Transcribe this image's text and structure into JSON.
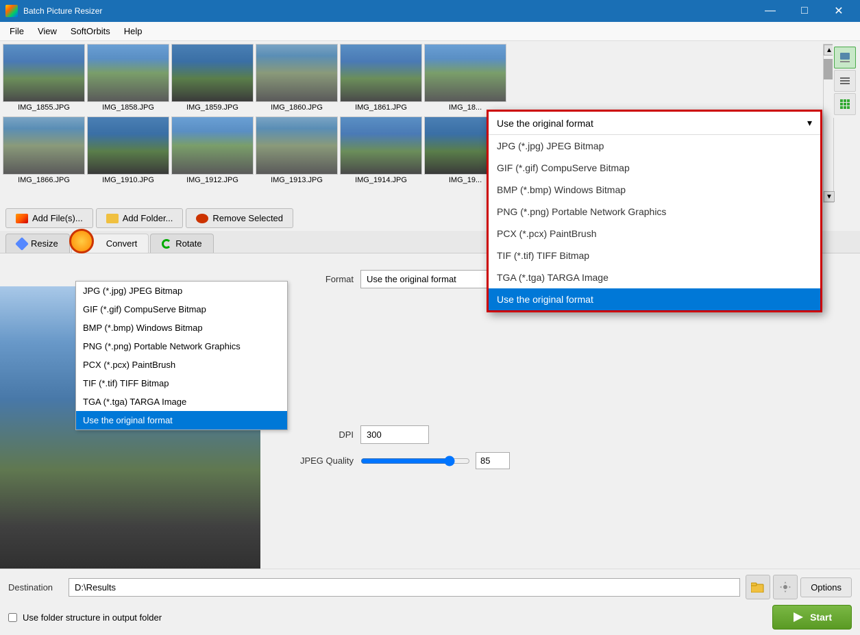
{
  "app": {
    "title": "Batch Picture Resizer",
    "icon_label": "app-icon"
  },
  "title_bar": {
    "title": "Batch Picture Resizer",
    "minimize": "—",
    "maximize": "□",
    "close": "✕"
  },
  "menu": {
    "items": [
      "File",
      "View",
      "SoftOrbits",
      "Help"
    ]
  },
  "thumbnails": [
    {
      "label": "IMG_1855.JPG",
      "style": "sea-img"
    },
    {
      "label": "IMG_1858.JPG",
      "style": "sea-img2"
    },
    {
      "label": "IMG_1859.JPG",
      "style": "sea-img3"
    },
    {
      "label": "IMG_1860.JPG",
      "style": "rocks-img"
    },
    {
      "label": "IMG_1861.JPG",
      "style": "sea-img"
    },
    {
      "label": "IMG_18...",
      "style": "sea-img2"
    },
    {
      "label": "IMG_1866.JPG",
      "style": "rocks-img"
    },
    {
      "label": "IMG_1910.JPG",
      "style": "sea-img3"
    },
    {
      "label": "IMG_1912.JPG",
      "style": "sea-img2"
    },
    {
      "label": "IMG_1913.JPG",
      "style": "rocks-img"
    },
    {
      "label": "IMG_1914.JPG",
      "style": "sea-img"
    },
    {
      "label": "IMG_19...",
      "style": "sea-img3"
    }
  ],
  "toolbar": {
    "add_files_label": "Add File(s)...",
    "add_folder_label": "Add Folder...",
    "remove_selected_label": "Remove Selected"
  },
  "tabs": {
    "resize_label": "Resize",
    "convert_label": "Convert",
    "rotate_label": "Rotate"
  },
  "convert_form": {
    "format_label": "Format",
    "dpi_label": "DPI",
    "jpeg_quality_label": "JPEG Quality",
    "format_selected": "Use the original format",
    "format_options": [
      "JPG (*.jpg) JPEG Bitmap",
      "GIF (*.gif) CompuServe Bitmap",
      "BMP (*.bmp) Windows Bitmap",
      "PNG (*.png) Portable Network Graphics",
      "PCX (*.pcx) PaintBrush",
      "TIF (*.tif) TIFF Bitmap",
      "TGA (*.tga) TARGA Image",
      "Use the original format"
    ],
    "dpi_value": "300",
    "jpeg_quality_value": "85"
  },
  "big_dropdown": {
    "header": "Use the original format",
    "items": [
      "JPG (*.jpg) JPEG Bitmap",
      "GIF (*.gif) CompuServe Bitmap",
      "BMP (*.bmp) Windows Bitmap",
      "PNG (*.png) Portable Network Graphics",
      "PCX (*.pcx) PaintBrush",
      "TIF (*.tif) TIFF Bitmap",
      "TGA (*.tga) TARGA Image",
      "Use the original format"
    ],
    "selected_index": 7
  },
  "bottom": {
    "destination_label": "Destination",
    "destination_value": "D:\\Results",
    "use_folder_structure_label": "Use folder structure in output folder",
    "options_label": "Options",
    "start_label": "Start"
  }
}
